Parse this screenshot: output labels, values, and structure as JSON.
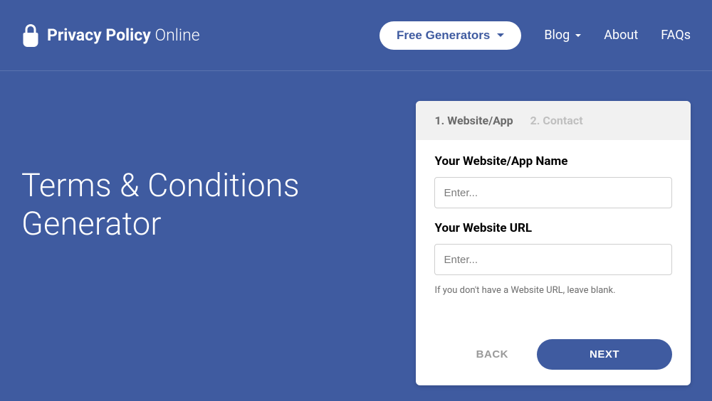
{
  "brand": {
    "bold": "Privacy Policy",
    "light": "Online"
  },
  "nav": {
    "generators": "Free Generators",
    "blog": "Blog",
    "about": "About",
    "faqs": "FAQs"
  },
  "hero": {
    "title": "Terms & Conditions Generator"
  },
  "wizard": {
    "steps": {
      "active": "1. Website/App",
      "inactive": "2. Contact"
    },
    "fields": {
      "name": {
        "label": "Your Website/App Name",
        "placeholder": "Enter..."
      },
      "url": {
        "label": "Your Website URL",
        "placeholder": "Enter...",
        "hint": "If you don't have a Website URL, leave blank."
      }
    },
    "buttons": {
      "back": "BACK",
      "next": "NEXT"
    }
  }
}
